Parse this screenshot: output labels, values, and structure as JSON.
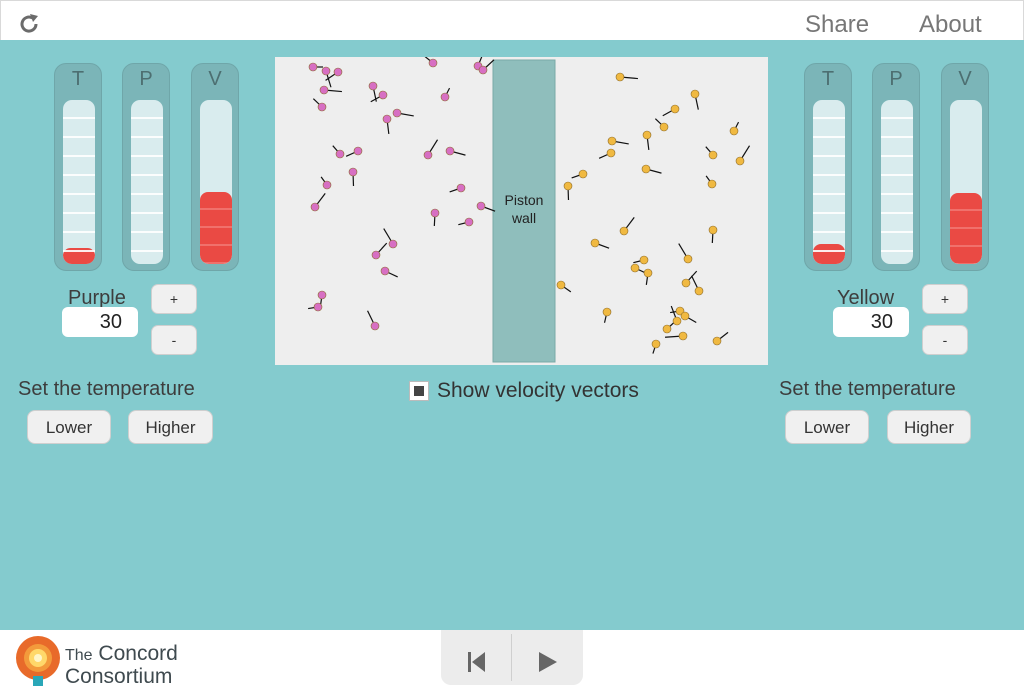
{
  "header": {
    "share_label": "Share",
    "about_label": "About",
    "reload_icon": "reload-icon"
  },
  "left_panel": {
    "gas_name": "Purple",
    "count_value": "30",
    "plus_label": "+",
    "minus_label": "-",
    "set_temp_title": "Set the temperature",
    "lower_label": "Lower",
    "higher_label": "Higher",
    "gauges": [
      {
        "label": "T",
        "level": 0.1
      },
      {
        "label": "P",
        "level": 0.0
      },
      {
        "label": "V",
        "level": 0.44
      }
    ]
  },
  "right_panel": {
    "gas_name": "Yellow",
    "count_value": "30",
    "plus_label": "+",
    "minus_label": "-",
    "set_temp_title": "Set the temperature",
    "lower_label": "Lower",
    "higher_label": "Higher",
    "gauges": [
      {
        "label": "T",
        "level": 0.12
      },
      {
        "label": "P",
        "level": 0.0
      },
      {
        "label": "V",
        "level": 0.43
      }
    ]
  },
  "simulation": {
    "piston_label_line1": "Piston",
    "piston_label_line2": "wall",
    "purple_color": "#d76fc3",
    "yellow_color": "#f0b941",
    "velocity_vectors_label": "Show velocity vectors",
    "velocity_vectors_checked": true
  },
  "footer": {
    "logo_line1": "The",
    "logo_line2": "Concord",
    "logo_line3": "Consortium",
    "reset_icon": "reset-icon",
    "play_icon": "play-icon"
  },
  "colors": {
    "main_bg": "#84cbce",
    "gauge_fill": "#ea4a44"
  }
}
